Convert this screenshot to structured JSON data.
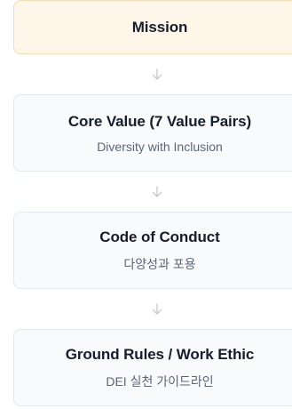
{
  "colors": {
    "mission_bg": "#fff6ea",
    "mission_border": "#f7ddb4",
    "card_bg": "#f8fafc",
    "card_border": "#e3e8ee",
    "title": "#161d2b",
    "subtitle": "#5c6678",
    "arrow": "#c3c9d2"
  },
  "arrow_icon": "arrow-down-icon",
  "mission": {
    "title": "Mission"
  },
  "core_value": {
    "title": "Core Value (7 Value Pairs)",
    "subtitle": "Diversity with Inclusion"
  },
  "code_of_conduct": {
    "title": "Code of Conduct",
    "subtitle": "다양성과 포용"
  },
  "ground_rules": {
    "title": "Ground Rules / Work Ethic",
    "subtitle": "DEI 실천 가이드라인"
  }
}
